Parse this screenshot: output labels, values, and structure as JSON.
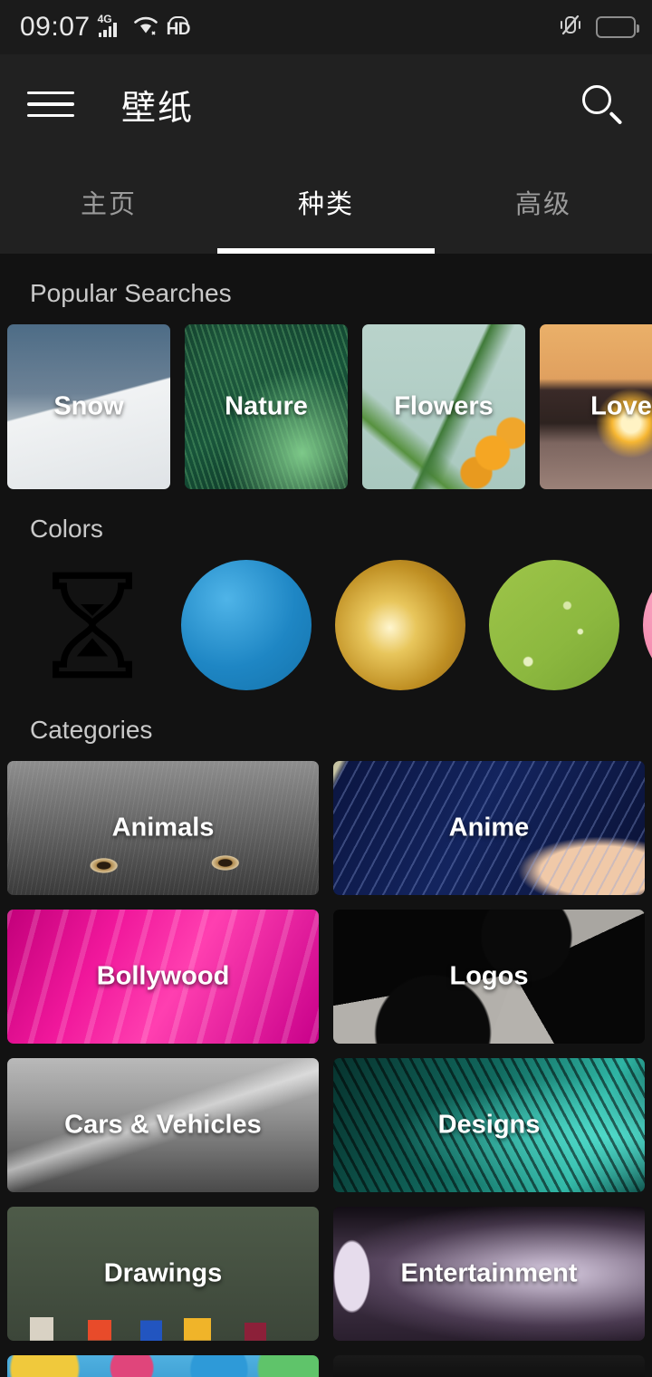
{
  "status_bar": {
    "time": "09:07",
    "network_label": "4G",
    "hd_label": "HD",
    "icons": [
      "signal-bars-icon",
      "wifi-icon",
      "hd-icon",
      "vibrate-icon",
      "battery-icon"
    ]
  },
  "app_bar": {
    "menu_icon": "hamburger-menu-icon",
    "title": "壁纸",
    "search_icon": "search-icon"
  },
  "tabs": {
    "active_index": 1,
    "items": [
      {
        "label": "主页"
      },
      {
        "label": "种类"
      },
      {
        "label": "高级"
      }
    ]
  },
  "popular_searches": {
    "title": "Popular Searches",
    "items": [
      {
        "label": "Snow",
        "image": "snowy-mountain"
      },
      {
        "label": "Nature",
        "image": "green-palm-leaves"
      },
      {
        "label": "Flowers",
        "image": "yellow-flowers"
      },
      {
        "label": "Love",
        "image": "heart-hands-sunset"
      }
    ]
  },
  "colors": {
    "title": "Colors",
    "placeholder_icon": "hourglass-icon",
    "items": [
      {
        "name": "blue",
        "hex": "#1e86c4"
      },
      {
        "name": "gold",
        "hex": "#c99a2b"
      },
      {
        "name": "green",
        "hex": "#8cb83f"
      },
      {
        "name": "pink",
        "hex": "#f58fb2"
      }
    ]
  },
  "categories": {
    "title": "Categories",
    "items": [
      {
        "label": "Animals",
        "image": "wolf-face"
      },
      {
        "label": "Anime",
        "image": "anime-girl-blue-hair"
      },
      {
        "label": "Bollywood",
        "image": "pink-silk-fabric"
      },
      {
        "label": "Logos",
        "image": "concrete-logo-shape"
      },
      {
        "label": "Cars & Vehicles",
        "image": "silver-car-body"
      },
      {
        "label": "Designs",
        "image": "teal-abstract-swirl"
      },
      {
        "label": "Drawings",
        "image": "colored-pencils"
      },
      {
        "label": "Entertainment",
        "image": "stage-light-smoke"
      },
      {
        "label": "",
        "image": "blue-dots-pattern"
      },
      {
        "label": "",
        "image": "dark-tile"
      }
    ]
  },
  "theme": {
    "background": "#121212",
    "app_bar_background": "#212121",
    "accent": "#ffffff",
    "section_title_color": "#c9c9c9"
  }
}
